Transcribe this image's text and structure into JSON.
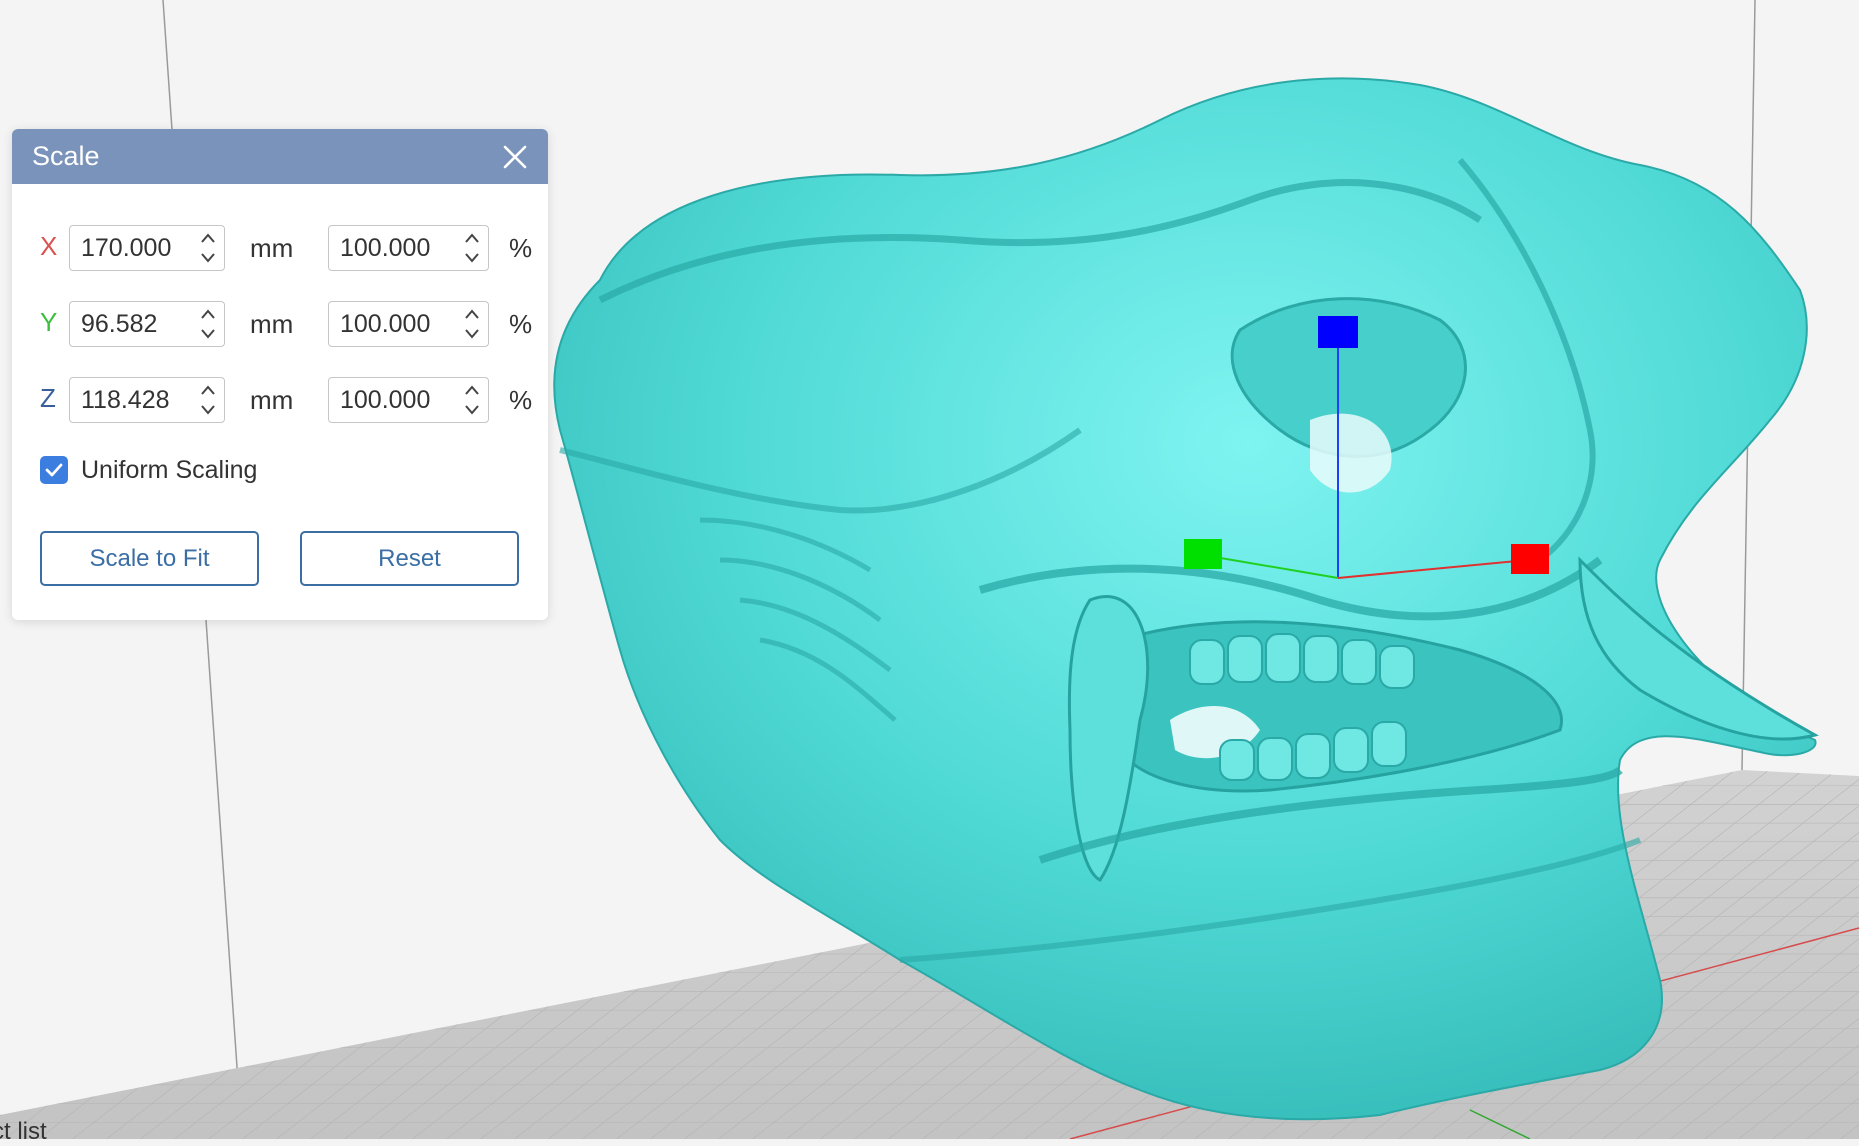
{
  "dialog": {
    "title": "Scale",
    "rows": [
      {
        "axis": "X",
        "axis_color": "#d9534f",
        "size": "170.000",
        "size_unit": "mm",
        "percent": "100.000",
        "percent_unit": "%"
      },
      {
        "axis": "Y",
        "axis_color": "#3cbf3c",
        "size": "96.582",
        "size_unit": "mm",
        "percent": "100.000",
        "percent_unit": "%"
      },
      {
        "axis": "Z",
        "axis_color": "#3a5e9c",
        "size": "118.428",
        "size_unit": "mm",
        "percent": "100.000",
        "percent_unit": "%"
      }
    ],
    "uniform_scaling": {
      "label": "Uniform Scaling",
      "checked": true
    },
    "buttons": {
      "scale_to_fit": "Scale to Fit",
      "reset": "Reset"
    }
  },
  "bottom_panel_label": "ct list",
  "colors": {
    "model": "#57e0dc",
    "gizmo_x": "#ff0000",
    "gizmo_y": "#00e000",
    "gizmo_z": "#0000ff",
    "header": "#7a93ba",
    "accent": "#3b7ee0"
  },
  "icons": [
    "close-icon",
    "spin-up-icon",
    "spin-down-icon",
    "checkmark-icon"
  ]
}
